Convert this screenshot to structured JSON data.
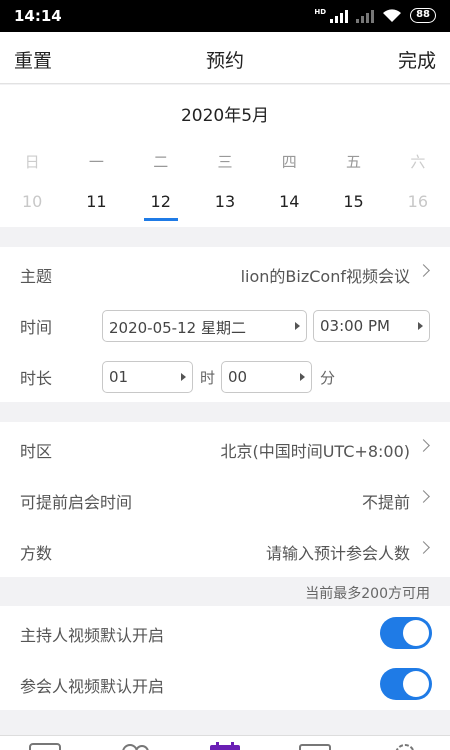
{
  "status_bar": {
    "time": "14:14",
    "hd_label": "HD",
    "battery": "88"
  },
  "nav": {
    "left": "重置",
    "title": "预约",
    "right": "完成"
  },
  "calendar": {
    "month": "2020年5月",
    "weekdays": [
      "日",
      "一",
      "二",
      "三",
      "四",
      "五",
      "六"
    ],
    "dates": [
      "10",
      "11",
      "12",
      "13",
      "14",
      "15",
      "16"
    ],
    "selected": "12"
  },
  "form": {
    "subject": {
      "label": "主题",
      "value": "lion的BizConf视频会议"
    },
    "time": {
      "label": "时间",
      "date": "2020-05-12 星期二",
      "clock": "03:00 PM"
    },
    "duration": {
      "label": "时长",
      "hours": "01",
      "hours_unit": "时",
      "minutes": "00",
      "minutes_unit": "分"
    },
    "timezone": {
      "label": "时区",
      "value": "北京(中国时间UTC+8:00)"
    },
    "early_join": {
      "label": "可提前启会时间",
      "value": "不提前"
    },
    "participants": {
      "label": "方数",
      "placeholder": "请输入预计参会人数"
    },
    "capacity_tip": "当前最多200方可用",
    "host_video": {
      "label": "主持人视频默认开启",
      "on": true
    },
    "attendee_video": {
      "label": "参会人视频默认开启",
      "on": true
    }
  },
  "colors": {
    "accent": "#1f7be6",
    "tab_active": "#6a1fb4"
  },
  "tabbar": {
    "icons": [
      "chat-icon",
      "contacts-icon",
      "calendar-icon",
      "message-icon",
      "settings-icon"
    ]
  }
}
